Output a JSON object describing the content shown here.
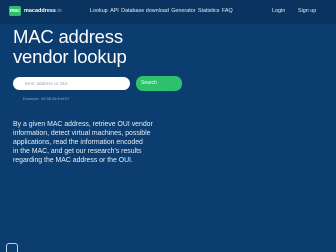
{
  "brand": {
    "icon_text": "mac",
    "name": "macaddress",
    "tld": ".io"
  },
  "nav": {
    "items": [
      "Lookup",
      "API",
      "Database download",
      "Generator",
      "Statistics",
      "FAQ"
    ],
    "login": "Login",
    "signup": "Sign up"
  },
  "hero": {
    "title_line1": "MAC address",
    "title_line2": "vendor lookup"
  },
  "search": {
    "placeholder": "MAC address or OUI",
    "button": "Search",
    "example": "Example: 44:38:39:ff:ef:57"
  },
  "description": {
    "lines": [
      "By a given MAC address, retrieve OUI vendor",
      "information, detect virtual machines, possible",
      "applications, read the information encoded",
      "in the MAC, and get our research's results",
      "regarding the MAC address or the OUI."
    ]
  },
  "colors": {
    "background": "#0c3d70",
    "navbar": "#0a345f",
    "accent_green": "#2ec16e"
  }
}
